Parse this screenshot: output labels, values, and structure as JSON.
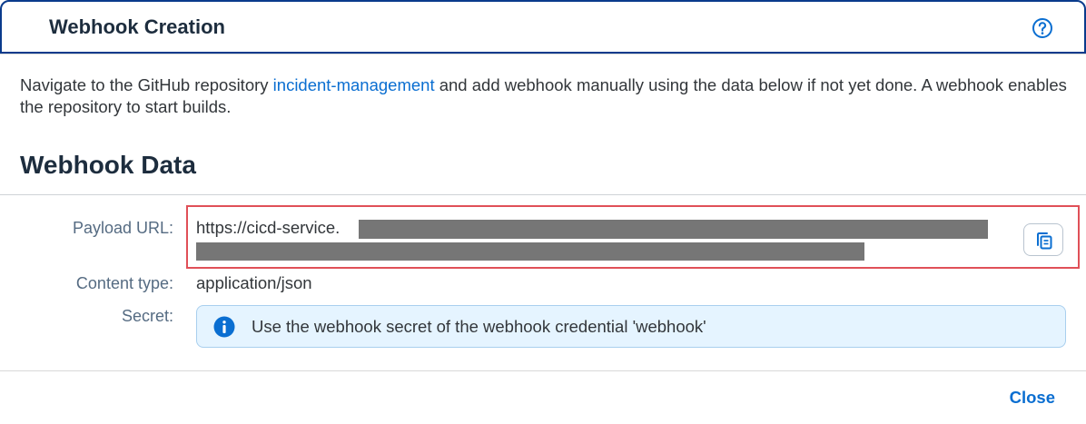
{
  "dialog": {
    "title": "Webhook Creation",
    "help_icon": "help-circle-icon"
  },
  "intro": {
    "before_link": "Navigate to the GitHub repository ",
    "link_text": "incident-management",
    "after_link": " and add webhook manually using the data below if not yet done. A webhook enables the repository to start builds."
  },
  "section": {
    "title": "Webhook Data"
  },
  "fields": {
    "payload_url": {
      "label": "Payload URL:",
      "value_visible": "https://cicd-service.",
      "copy_icon": "copy-icon"
    },
    "content_type": {
      "label": "Content type:",
      "value": "application/json"
    },
    "secret": {
      "label": "Secret:",
      "info_icon": "info-icon",
      "message": "Use the webhook secret of the webhook credential 'webhook'"
    }
  },
  "footer": {
    "close_label": "Close"
  },
  "colors": {
    "header_border": "#0a3b8c",
    "link": "#0a6ed1",
    "highlight_border": "#e05058",
    "info_bg": "#e5f4ff",
    "info_icon": "#0a6ed1",
    "redaction": "#767676"
  }
}
